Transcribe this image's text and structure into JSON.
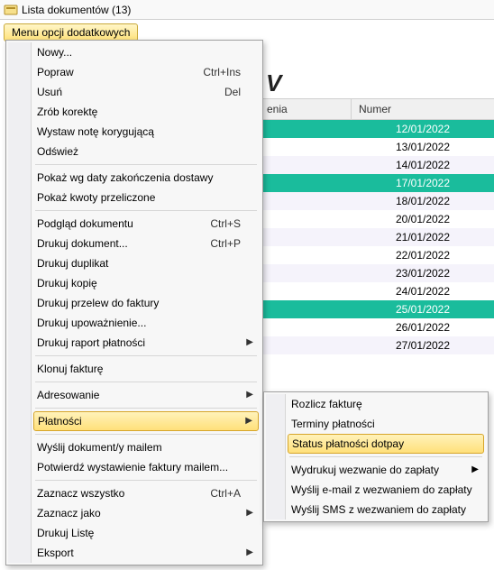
{
  "window": {
    "title": "Lista dokumentów (13)"
  },
  "toolbar": {
    "menu_button": "Menu opcji dodatkowych"
  },
  "bg": {
    "partial_letter": "V",
    "col_header_left": "enia",
    "col_header_numer": "Numer"
  },
  "grid_rows": [
    {
      "date": "12/01/2022",
      "style": "teal"
    },
    {
      "date": "13/01/2022",
      "style": ""
    },
    {
      "date": "14/01/2022",
      "style": "alt"
    },
    {
      "date": "17/01/2022",
      "style": "teal"
    },
    {
      "date": "18/01/2022",
      "style": "alt"
    },
    {
      "date": "20/01/2022",
      "style": ""
    },
    {
      "date": "21/01/2022",
      "style": "alt"
    },
    {
      "date": "22/01/2022",
      "style": ""
    },
    {
      "date": "23/01/2022",
      "style": "alt"
    },
    {
      "date": "24/01/2022",
      "style": ""
    },
    {
      "date": "25/01/2022",
      "style": "teal"
    },
    {
      "date": "26/01/2022",
      "style": ""
    },
    {
      "date": "27/01/2022",
      "style": "alt"
    }
  ],
  "menu": [
    {
      "label": "Nowy...",
      "shortcut": "",
      "arrow": false,
      "sep_after": false,
      "highlight": false
    },
    {
      "label": "Popraw",
      "shortcut": "Ctrl+Ins",
      "arrow": false,
      "sep_after": false,
      "highlight": false
    },
    {
      "label": "Usuń",
      "shortcut": "Del",
      "arrow": false,
      "sep_after": false,
      "highlight": false
    },
    {
      "label": "Zrób korektę",
      "shortcut": "",
      "arrow": false,
      "sep_after": false,
      "highlight": false
    },
    {
      "label": "Wystaw notę korygującą",
      "shortcut": "",
      "arrow": false,
      "sep_after": false,
      "highlight": false
    },
    {
      "label": "Odśwież",
      "shortcut": "",
      "arrow": false,
      "sep_after": true,
      "highlight": false
    },
    {
      "label": "Pokaż wg daty zakończenia dostawy",
      "shortcut": "",
      "arrow": false,
      "sep_after": false,
      "highlight": false
    },
    {
      "label": "Pokaż kwoty przeliczone",
      "shortcut": "",
      "arrow": false,
      "sep_after": true,
      "highlight": false
    },
    {
      "label": "Podgląd dokumentu",
      "shortcut": "Ctrl+S",
      "arrow": false,
      "sep_after": false,
      "highlight": false
    },
    {
      "label": "Drukuj dokument...",
      "shortcut": "Ctrl+P",
      "arrow": false,
      "sep_after": false,
      "highlight": false
    },
    {
      "label": "Drukuj duplikat",
      "shortcut": "",
      "arrow": false,
      "sep_after": false,
      "highlight": false
    },
    {
      "label": "Drukuj kopię",
      "shortcut": "",
      "arrow": false,
      "sep_after": false,
      "highlight": false
    },
    {
      "label": "Drukuj przelew do faktury",
      "shortcut": "",
      "arrow": false,
      "sep_after": false,
      "highlight": false
    },
    {
      "label": "Drukuj upoważnienie...",
      "shortcut": "",
      "arrow": false,
      "sep_after": false,
      "highlight": false
    },
    {
      "label": "Drukuj raport płatności",
      "shortcut": "",
      "arrow": true,
      "sep_after": true,
      "highlight": false
    },
    {
      "label": "Klonuj fakturę",
      "shortcut": "",
      "arrow": false,
      "sep_after": true,
      "highlight": false
    },
    {
      "label": "Adresowanie",
      "shortcut": "",
      "arrow": true,
      "sep_after": true,
      "highlight": false
    },
    {
      "label": "Płatności",
      "shortcut": "",
      "arrow": true,
      "sep_after": true,
      "highlight": true
    },
    {
      "label": "Wyślij dokument/y mailem",
      "shortcut": "",
      "arrow": false,
      "sep_after": false,
      "highlight": false
    },
    {
      "label": "Potwierdź wystawienie faktury mailem...",
      "shortcut": "",
      "arrow": false,
      "sep_after": true,
      "highlight": false
    },
    {
      "label": "Zaznacz wszystko",
      "shortcut": "Ctrl+A",
      "arrow": false,
      "sep_after": false,
      "highlight": false
    },
    {
      "label": "Zaznacz jako",
      "shortcut": "",
      "arrow": true,
      "sep_after": false,
      "highlight": false
    },
    {
      "label": "Drukuj Listę",
      "shortcut": "",
      "arrow": false,
      "sep_after": false,
      "highlight": false
    },
    {
      "label": "Eksport",
      "shortcut": "",
      "arrow": true,
      "sep_after": false,
      "highlight": false
    }
  ],
  "submenu": [
    {
      "label": "Rozlicz fakturę",
      "arrow": false,
      "sep_after": false,
      "highlight": false
    },
    {
      "label": "Terminy płatności",
      "arrow": false,
      "sep_after": false,
      "highlight": false
    },
    {
      "label": "Status płatności dotpay",
      "arrow": false,
      "sep_after": true,
      "highlight": true
    },
    {
      "label": "Wydrukuj wezwanie do zapłaty",
      "arrow": true,
      "sep_after": false,
      "highlight": false
    },
    {
      "label": "Wyślij e-mail z wezwaniem do zapłaty",
      "arrow": false,
      "sep_after": false,
      "highlight": false
    },
    {
      "label": "Wyślij SMS z wezwaniem do zapłaty",
      "arrow": false,
      "sep_after": false,
      "highlight": false
    }
  ]
}
